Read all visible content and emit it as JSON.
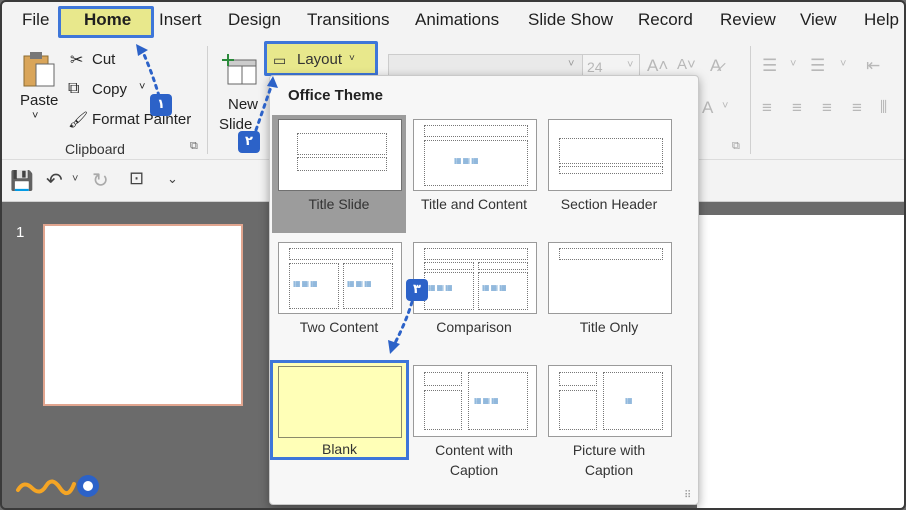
{
  "tabs": [
    "File",
    "Home",
    "Insert",
    "Design",
    "Transitions",
    "Animations",
    "Slide Show",
    "Record",
    "Review",
    "View",
    "Help"
  ],
  "clipboard": {
    "paste": "Paste",
    "cut": "Cut",
    "copy": "Copy",
    "format_painter": "Format Painter",
    "group": "Clipboard"
  },
  "slides": {
    "new_slide_1": "New",
    "new_slide_2": "Slide"
  },
  "layout_button": "Layout",
  "font_size": "24",
  "dropdown": {
    "title": "Office Theme",
    "layouts": [
      {
        "label": "Title Slide"
      },
      {
        "label": "Title and Content"
      },
      {
        "label": "Section Header"
      },
      {
        "label": "Two Content"
      },
      {
        "label": "Comparison"
      },
      {
        "label": "Title Only"
      },
      {
        "label": "Blank"
      },
      {
        "label": "Content with",
        "label2": "Caption"
      },
      {
        "label": "Picture with",
        "label2": "Caption"
      }
    ]
  },
  "slide_number": "1",
  "steps": [
    "۱",
    "۲",
    "۳"
  ],
  "colors": {
    "highlight": "#e8e88c",
    "accent_blue": "#3e76d9",
    "blank_fill": "#ffffb7"
  }
}
